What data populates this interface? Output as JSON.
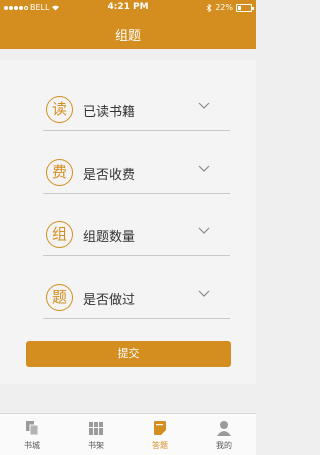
{
  "status_bar": {
    "carrier": "BELL",
    "time": "4:21 PM",
    "battery": "22%",
    "battery_level": 0.22,
    "bluetooth_icon": "bluetooth-icon",
    "wifi_icon": "wifi-icon"
  },
  "header": {
    "title": "组题"
  },
  "filters": [
    {
      "badge": "读",
      "label": "已读书籍"
    },
    {
      "badge": "费",
      "label": "是否收费"
    },
    {
      "badge": "组",
      "label": "组题数量"
    },
    {
      "badge": "题",
      "label": "是否做过"
    }
  ],
  "submit_label": "提交",
  "tabs": [
    {
      "label": "书城",
      "icon": "bookstore-icon"
    },
    {
      "label": "书架",
      "icon": "bookshelf-icon"
    },
    {
      "label": "答题",
      "icon": "answer-icon",
      "active": true
    },
    {
      "label": "我的",
      "icon": "profile-icon"
    }
  ],
  "colors": {
    "accent": "#d38e1f",
    "background": "#efefef",
    "card": "#f4f4f4"
  }
}
